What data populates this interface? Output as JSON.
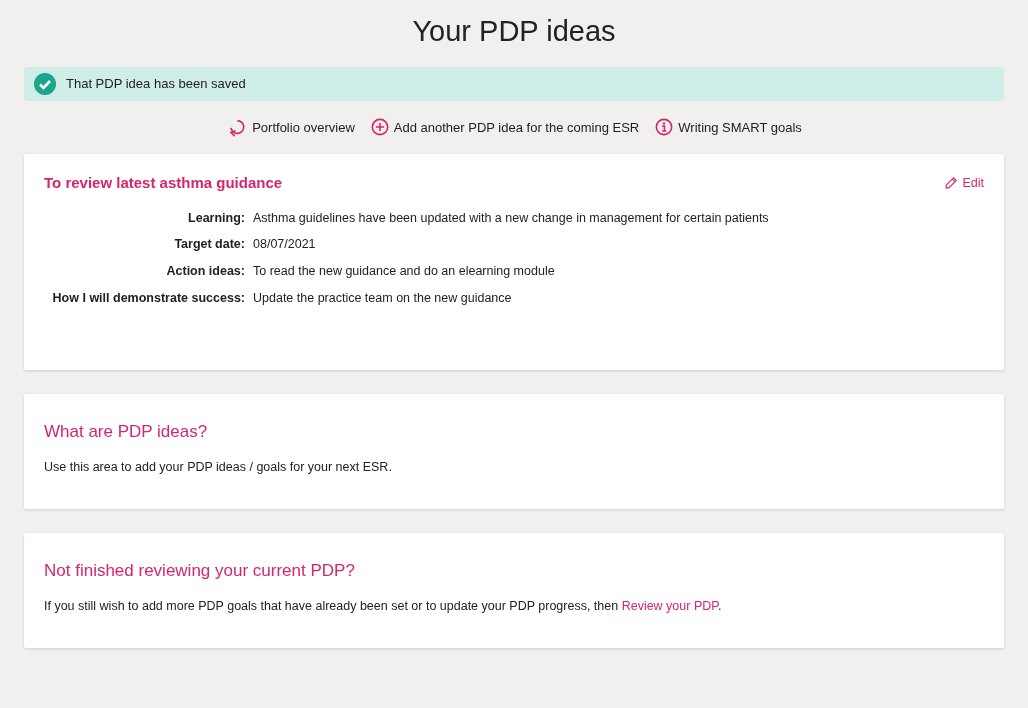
{
  "page_title": "Your PDP ideas",
  "alert": {
    "kind": "success",
    "text": "That PDP idea has been saved"
  },
  "links": [
    {
      "kind": "refresh",
      "label": "Portfolio overview"
    },
    {
      "kind": "add",
      "label": "Add another PDP idea for the coming ESR"
    },
    {
      "kind": "info",
      "label": "Writing SMART goals"
    }
  ],
  "idea": {
    "title": "To review latest asthma guidance",
    "edit_label": "Edit",
    "fields": [
      {
        "label": "Learning:",
        "value": "Asthma guidelines have been updated with a new change in management for certain patients"
      },
      {
        "label": "Target date:",
        "value": "08/07/2021"
      },
      {
        "label": "Action ideas:",
        "value": "To read the new guidance and do an elearning module"
      },
      {
        "label": "How I will demonstrate success:",
        "value": "Update the practice team on the new guidance"
      }
    ]
  },
  "info_cards": [
    {
      "title": "What are PDP ideas?",
      "text": "Use this area to add your PDP ideas / goals for your next ESR."
    },
    {
      "title": "Not finished reviewing your current PDP?",
      "text": "If you still wish to add more PDP goals that have already been set or to update your PDP progress, then ",
      "link": "Review your PDP",
      "text_after": "."
    }
  ]
}
